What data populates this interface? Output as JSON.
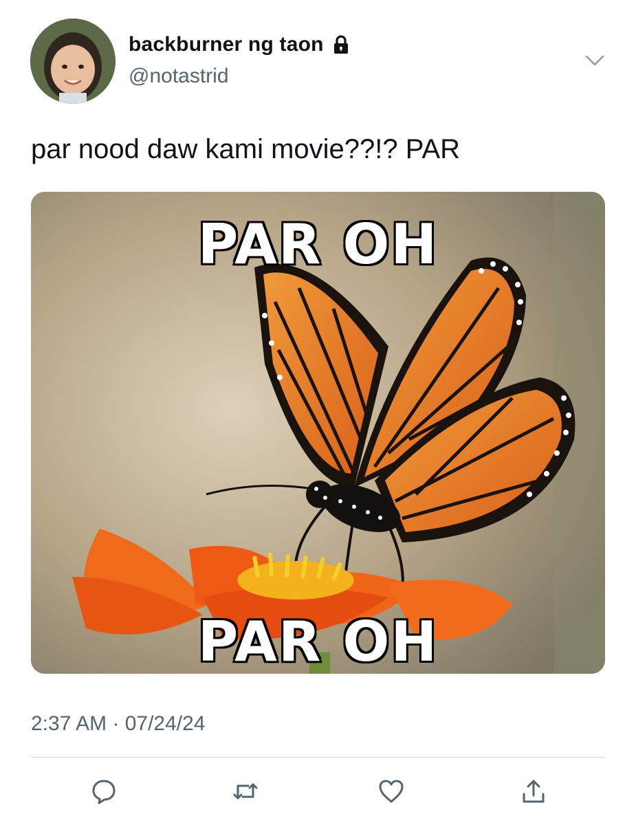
{
  "tweet": {
    "display_name": "backburner ng taon",
    "handle": "@notastrid",
    "text": "par nood daw kami movie??!? PAR",
    "timestamp": "2:37 AM · 07/24/24",
    "media": {
      "caption_top": "PAR OH",
      "caption_bottom": "PAR OH"
    }
  },
  "icons": {
    "locked": "lock-icon",
    "menu": "chevron-down-icon",
    "reply": "reply-icon",
    "retweet": "retweet-icon",
    "like": "heart-icon",
    "share": "share-icon"
  },
  "colors": {
    "text": "#0f1419",
    "secondary": "#536471",
    "divider": "#cfd9de"
  }
}
